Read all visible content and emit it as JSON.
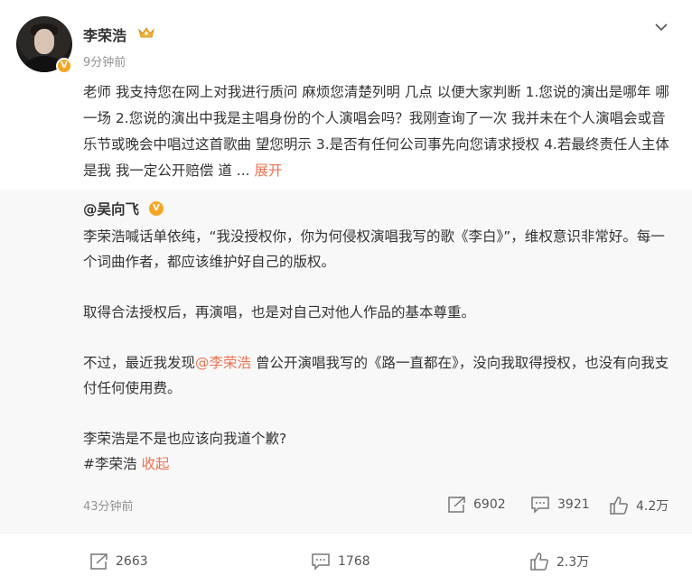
{
  "post": {
    "username": "李荣浩",
    "time": "9分钟前",
    "text": "老师 我支持您在网上对我进行质问 麻烦您清楚列明 几点  以便大家判断 1.您说的演出是哪年 哪一场  2.您说的演出中我是主唱身份的个人演唱会吗？我刚查询了一次 我并未在个人演唱会或音乐节或晚会中唱过这首歌曲 望您明示 3.是否有任何公司事先向您请求授权  4.若最终责任人主体是我 我一定公开赔偿 道 ... ",
    "expand_label": "展开",
    "stats": {
      "repost": "2663",
      "comment": "1768",
      "like": "2.3万"
    }
  },
  "repost": {
    "author": "@吴向飞",
    "para1": "李荣浩喊话单依纯，“我没授权你，你为何侵权演唱我写的歌《李白》”，维权意识非常好。每一个词曲作者，都应该维护好自己的版权。",
    "para2": "取得合法授权后，再演唱，也是对自己对他人作品的基本尊重。",
    "para3_pre": "不过，最近我发现",
    "para3_mention": "@李荣浩",
    "para3_post": " 曾公开演唱我写的《路一直都在》，没向我取得授权，也没有向我支付任何使用费。",
    "para4": "李荣浩是不是也应该向我道个歉?",
    "hashtag": "#李荣浩",
    "collapse_label": "收起",
    "time": "43分钟前",
    "stats": {
      "repost": "6902",
      "comment": "3921",
      "like": "4.2万"
    }
  },
  "colors": {
    "accent": "#eb7350",
    "badge": "#f5a623",
    "muted": "#939393",
    "repost_bg": "#f8f8f8"
  },
  "icons": [
    "verified-badge-icon",
    "crown-icon",
    "chevron-down-icon",
    "share-icon",
    "comment-icon",
    "like-icon"
  ]
}
